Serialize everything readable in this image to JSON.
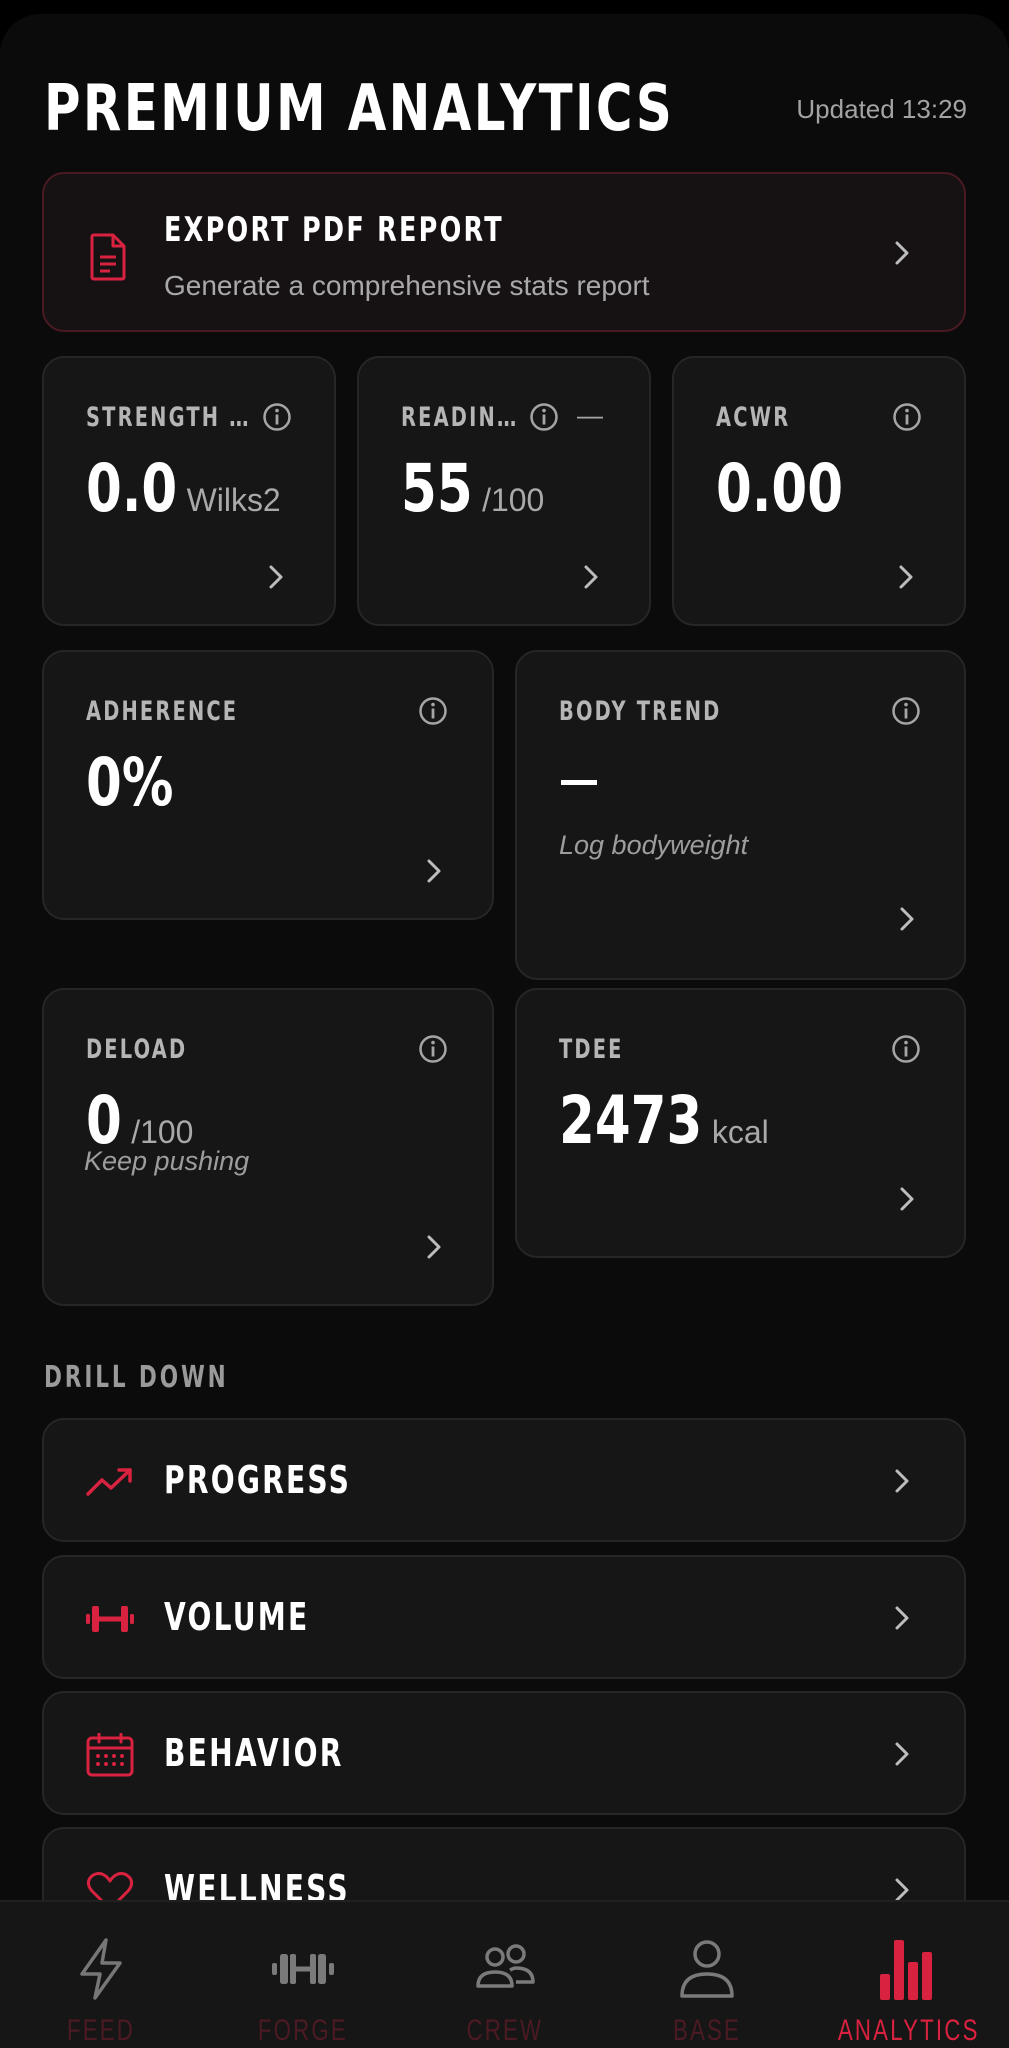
{
  "header": {
    "title": "PREMIUM ANALYTICS",
    "updated": "Updated 13:29"
  },
  "export": {
    "title": "EXPORT PDF REPORT",
    "subtitle": "Generate a comprehensive stats report",
    "icon": "document-icon"
  },
  "stats": {
    "strength": {
      "label": "STRENGTH …",
      "value": "0.0",
      "unit": "Wilks2"
    },
    "readiness": {
      "label": "READIN…",
      "value": "55",
      "unit": "/100",
      "trend": "—"
    },
    "acwr": {
      "label": "ACWR",
      "value": "0.00"
    },
    "adherence": {
      "label": "ADHERENCE",
      "value": "0%"
    },
    "body_trend": {
      "label": "BODY TREND",
      "note": "Log bodyweight"
    },
    "deload": {
      "label": "DELOAD",
      "value": "0",
      "unit": "/100",
      "note": "Keep pushing"
    },
    "tdee": {
      "label": "TDEE",
      "value": "2473",
      "unit": "kcal"
    }
  },
  "drill_down": {
    "label": "DRILL DOWN",
    "items": [
      {
        "label": "PROGRESS",
        "icon": "trending-up-icon"
      },
      {
        "label": "VOLUME",
        "icon": "dumbbell-icon"
      },
      {
        "label": "BEHAVIOR",
        "icon": "calendar-icon"
      },
      {
        "label": "WELLNESS",
        "icon": "heart-icon"
      }
    ]
  },
  "nav": {
    "items": [
      {
        "label": "FEED",
        "icon": "bolt-icon"
      },
      {
        "label": "FORGE",
        "icon": "dumbbell-icon"
      },
      {
        "label": "CREW",
        "icon": "people-icon"
      },
      {
        "label": "BASE",
        "icon": "person-icon"
      },
      {
        "label": "ANALYTICS",
        "icon": "bar-chart-icon",
        "active": true
      }
    ]
  },
  "colors": {
    "accent": "#d8223f",
    "background": "#0b0b0b",
    "card": "#161616",
    "muted_text": "#a9a9a9"
  }
}
